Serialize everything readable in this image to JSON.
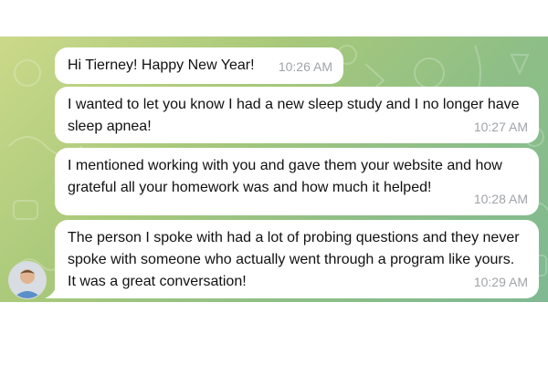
{
  "messages": [
    {
      "text": "Hi Tierney! Happy New Year!",
      "time": "10:26 AM"
    },
    {
      "text": "I wanted to let you know I had a new sleep study and I no longer have sleep apnea!",
      "time": "10:27 AM"
    },
    {
      "text": "I mentioned working with you and gave them your website and how grateful all your homework was and how much it helped!",
      "time": "10:28 AM"
    },
    {
      "text": "The person I spoke with had a lot of probing questions and they never spoke with someone who actually went through a program like yours. It was a great conversation!",
      "time": "10:29 AM"
    }
  ],
  "colors": {
    "bubble": "#ffffff",
    "timestamp": "#a0a4a8",
    "wallpaper_start": "#cbd98a",
    "wallpaper_end": "#7fb992"
  },
  "icons": [
    "user-avatar"
  ]
}
